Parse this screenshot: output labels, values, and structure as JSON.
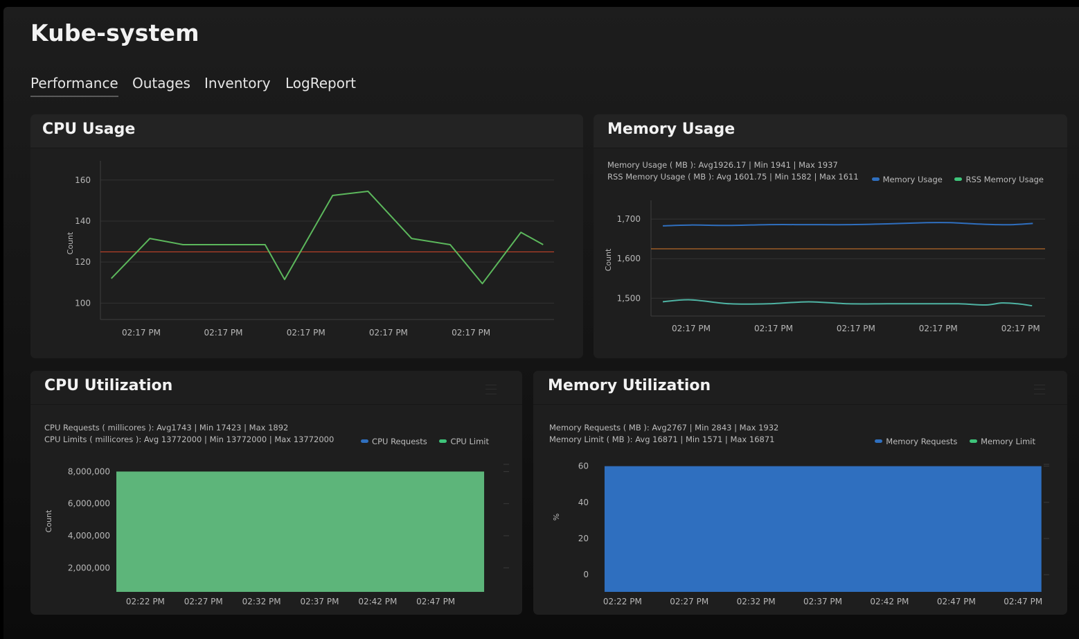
{
  "page": {
    "title": "Kube-system"
  },
  "tabs": [
    {
      "label": "Performance",
      "active": true
    },
    {
      "label": "Outages",
      "active": false
    },
    {
      "label": "Inventory",
      "active": false
    },
    {
      "label": "LogReport",
      "active": false
    }
  ],
  "colors": {
    "green": "#5cb85c",
    "fill_green": "#5db57a",
    "blue": "#2f6fbf",
    "teal": "#4fb4a4",
    "red": "#d9482b",
    "orange": "#d97a2b"
  },
  "panels": {
    "cpu_usage": {
      "title": "CPU Usage",
      "ylabel": "Count"
    },
    "memory_usage": {
      "title": "Memory Usage",
      "ylabel": "Count",
      "stats": [
        "Memory Usage ( MB ): Avg1926.17 | Min 1941 | Max 1937",
        "RSS Memory Usage ( MB ): Avg 1601.75 | Min 1582 | Max 1611"
      ],
      "legend": [
        {
          "label": "Memory Usage",
          "color": "#2f6fbf"
        },
        {
          "label": "RSS Memory Usage",
          "color": "#3ec47a"
        }
      ]
    },
    "cpu_utilization": {
      "title": "CPU Utilization",
      "ylabel": "Count",
      "stats": [
        "CPU Requests ( millicores ): Avg1743 | Min 17423 | Max 1892",
        "CPU Limits ( millicores ): Avg 13772000 | Min 13772000 | Max 13772000"
      ],
      "legend": [
        {
          "label": "CPU Requests",
          "color": "#2f6fbf"
        },
        {
          "label": "CPU Limit",
          "color": "#3ec47a"
        }
      ]
    },
    "memory_utilization": {
      "title": "Memory Utilization",
      "ylabel": "%",
      "stats": [
        "Memory Requests ( MB ): Avg2767 | Min 2843 | Max 1932",
        "Memory Limit ( MB ): Avg 16871 | Min 1571 | Max 16871"
      ],
      "legend": [
        {
          "label": "Memory Requests",
          "color": "#2f6fbf"
        },
        {
          "label": "Memory Limit",
          "color": "#3ec47a"
        }
      ]
    }
  },
  "chart_data": [
    {
      "id": "cpu_usage",
      "type": "line",
      "ylabel": "Count",
      "ylim": [
        92,
        166
      ],
      "grid": true,
      "yticks": [
        100,
        120,
        140,
        160
      ],
      "xtick_labels": [
        "02:17 PM",
        "02:17 PM",
        "02:17 PM",
        "02:17 PM",
        "02:17 PM"
      ],
      "x_range": [
        0,
        100
      ],
      "xtick_positions": [
        9,
        27.1,
        45.3,
        63.5,
        81.7
      ],
      "series": [
        {
          "color": "#5cb85c",
          "x": [
            2.4,
            10.9,
            18.2,
            30.3,
            36.3,
            40.6,
            51.2,
            59.0,
            68.6,
            77.1,
            84.2,
            92.7,
            97.6
          ],
          "y": [
            112,
            131.5,
            128.5,
            128.5,
            128.5,
            111.5,
            152.5,
            154.5,
            131.5,
            128.5,
            109.5,
            134.5,
            128.5
          ]
        }
      ],
      "reference_lines": [
        {
          "y": 125,
          "color": "#d9482b"
        }
      ]
    },
    {
      "id": "memory_usage",
      "type": "line",
      "ylabel": "Count",
      "ylim": [
        1455,
        1730
      ],
      "grid": true,
      "yticks": [
        1500,
        1600,
        1700
      ],
      "ytick_labels": [
        "1,500",
        "1,600",
        "1,700"
      ],
      "xtick_labels": [
        "02:17 PM",
        "02:17 PM",
        "02:17 PM",
        "02:17 PM",
        "02:17 PM"
      ],
      "x_range": [
        0,
        100
      ],
      "xtick_positions": [
        10.2,
        31.1,
        52.0,
        72.9,
        93.8
      ],
      "legend": "top-right",
      "series": [
        {
          "name": "Memory Usage",
          "color": "#2f6fbf",
          "smooth": true,
          "x": [
            3,
            10,
            20,
            30,
            40,
            50,
            60,
            70,
            76,
            82,
            88,
            92,
            96.9
          ],
          "y": [
            1683,
            1685,
            1684,
            1686,
            1686,
            1686,
            1688,
            1691,
            1691,
            1688,
            1686,
            1686,
            1689
          ]
        },
        {
          "name": "RSS Memory Usage",
          "color": "#4fb4a4",
          "smooth": true,
          "x": [
            3,
            10,
            20,
            30,
            40,
            50,
            60,
            70,
            78,
            85,
            89,
            93,
            96.7
          ],
          "y": [
            1491,
            1496,
            1486,
            1486,
            1491,
            1486,
            1486,
            1486,
            1486,
            1483,
            1488,
            1486,
            1481
          ]
        }
      ],
      "reference_lines": [
        {
          "y": 1625,
          "color": "#d97a2b"
        }
      ]
    },
    {
      "id": "cpu_utilization",
      "type": "area",
      "ylabel": "Count",
      "ylim": [
        500000,
        8450000
      ],
      "grid": false,
      "yticks": [
        2000000,
        4000000,
        6000000,
        8000000
      ],
      "ytick_labels": [
        "2,000,000",
        "4,000,000",
        "6,000,000",
        "8,000,000"
      ],
      "xtick_labels": [
        "02:22 PM",
        "02:27 PM",
        "02:32 PM",
        "02:37 PM",
        "02:42 PM",
        "02:47 PM"
      ],
      "x_range": [
        0,
        100
      ],
      "xtick_positions": [
        7.5,
        22.5,
        37.5,
        52.5,
        67.5,
        82.5
      ],
      "legend": "top-right",
      "series": [
        {
          "name": "CPU Limit",
          "color": "#5db57a",
          "x": [
            0,
            95
          ],
          "y": [
            8000000,
            8000000
          ]
        }
      ]
    },
    {
      "id": "memory_utilization",
      "type": "area",
      "ylabel": "%",
      "ylim": [
        -9.5,
        61
      ],
      "grid": false,
      "yticks": [
        0,
        20,
        40,
        60
      ],
      "xtick_labels": [
        "02:22 PM",
        "02:27 PM",
        "02:32 PM",
        "02:37 PM",
        "02:42 PM",
        "02:47 PM",
        "02:47 PM"
      ],
      "x_range": [
        0,
        100
      ],
      "xtick_positions": [
        6.0,
        20.9,
        35.8,
        50.7,
        65.6,
        80.5,
        95.4
      ],
      "legend": "top-right",
      "series": [
        {
          "name": "Memory Requests",
          "color": "#2f6fbf",
          "x": [
            2,
            99.5
          ],
          "y": [
            60,
            60
          ]
        }
      ]
    }
  ]
}
